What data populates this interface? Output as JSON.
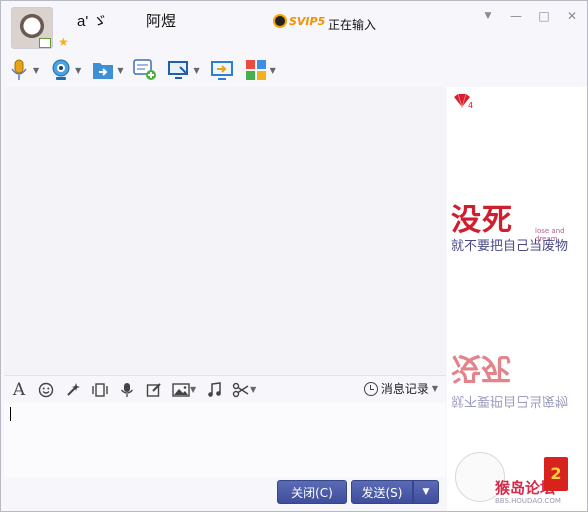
{
  "header": {
    "nickname": "a' ゞ",
    "remark": "阿煜",
    "svip_badge": "SVIP5",
    "status_text": "正在输入",
    "star_icon": "star-icon"
  },
  "window_controls": {
    "dropdown_icon": "▼",
    "minimize_icon": "—",
    "maximize_icon": "□",
    "close_icon": "✕"
  },
  "toolbar": {
    "items": [
      {
        "name": "voice-call",
        "icon": "microphone-icon",
        "has_dropdown": true
      },
      {
        "name": "video-call",
        "icon": "webcam-icon",
        "has_dropdown": true
      },
      {
        "name": "send-file",
        "icon": "folder-transfer-icon",
        "has_dropdown": true
      },
      {
        "name": "create-discussion",
        "icon": "chat-add-icon",
        "has_dropdown": false
      },
      {
        "name": "remote-desktop",
        "icon": "remote-screen-icon",
        "has_dropdown": true
      },
      {
        "name": "screen-share",
        "icon": "screen-share-icon",
        "has_dropdown": false
      },
      {
        "name": "apps",
        "icon": "app-grid-icon",
        "has_dropdown": true
      }
    ]
  },
  "input_toolbar": {
    "font_label": "A",
    "history_label": "消息记录"
  },
  "ad": {
    "big_text": "没死",
    "small_text": "lose and dream",
    "line_text": "就不要把自己当废物",
    "badge_number": "4",
    "logo_text": "猴岛论坛",
    "url_text": "BBS.HOUDAO.COM",
    "redbox_text": "2"
  },
  "buttons": {
    "close_label": "关闭(C)",
    "send_label": "发送(S)",
    "send_dropdown": "▼"
  },
  "colors": {
    "accent": "#4a59a8",
    "background": "#f7f6fb",
    "ad_red": "#d01e2e"
  }
}
